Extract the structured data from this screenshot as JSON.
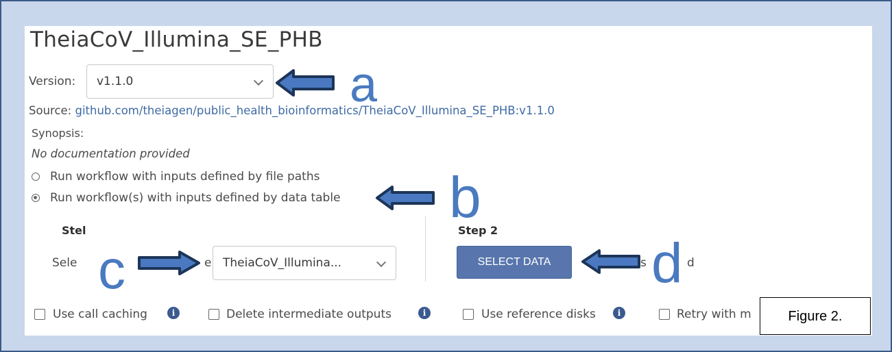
{
  "workflow": {
    "title": "TheiaCoV_Illumina_SE_PHB",
    "version_label": "Version:",
    "version_value": "v1.1.0",
    "source_label": "Source:",
    "source_link": "github.com/theiagen/public_health_bioinformatics/TheiaCoV_Illumina_SE_PHB:v1.1.0",
    "synopsis_label": "Synopsis:",
    "synopsis_value": "No documentation provided"
  },
  "run_options": [
    {
      "label": "Run workflow with inputs defined by file paths",
      "selected": false
    },
    {
      "label": "Run workflow(s) with inputs defined by data table",
      "selected": true
    }
  ],
  "step1": {
    "title": "Stel",
    "select_label_prefix": "Sele",
    "select_label_mid": "e",
    "select_label_suffix": "e:",
    "dropdown_value": "TheiaCoV_Illumina..."
  },
  "step2": {
    "title": "Step 2",
    "button_label": "SELECT DATA",
    "trailing_text_1": "s",
    "trailing_text_2": "d"
  },
  "options": [
    {
      "label": "Use call caching",
      "checked": false
    },
    {
      "label": "Delete intermediate outputs",
      "checked": false
    },
    {
      "label": "Use reference disks",
      "checked": false
    },
    {
      "label": "Retry with m",
      "checked": false
    }
  ],
  "annotations": {
    "a": "a",
    "b": "b",
    "c": "c",
    "d": "d",
    "figure_caption": "Figure 2."
  },
  "colors": {
    "background": "#c9d7ec",
    "frame": "#3a5a87",
    "link": "#3f6aa5",
    "button": "#5876ad",
    "annotation_letter": "#4a7abf",
    "arrow_fill": "#4a79c1",
    "arrow_outline": "#1c3558"
  }
}
